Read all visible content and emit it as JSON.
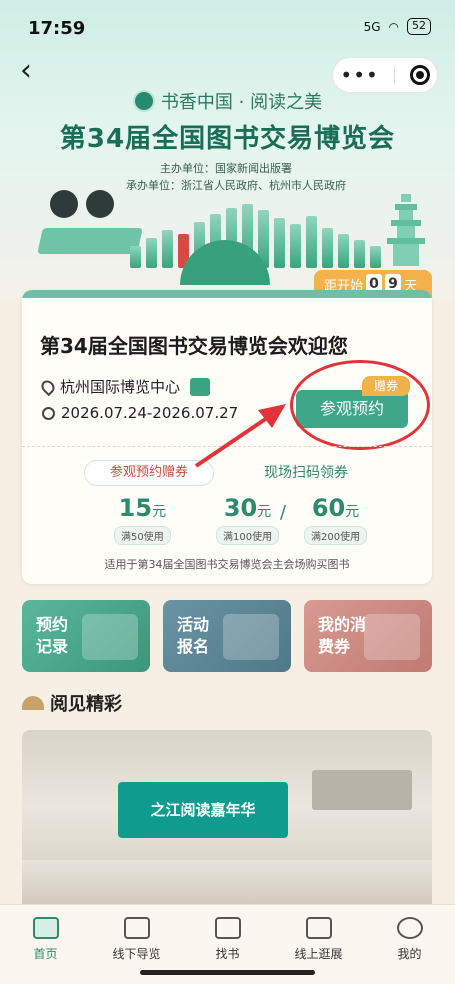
{
  "status_bar": {
    "time": "17:59",
    "battery": "52",
    "net": "5G"
  },
  "brand": {
    "name": "书香中国 · 阅读之美"
  },
  "header": {
    "title": "第34届全国图书交易博览会",
    "organizer": "主办单位：国家新闻出版署",
    "host": "承办单位：浙江省人民政府、杭州市人民政府"
  },
  "countdown": {
    "prefix": "距开始",
    "digits": [
      "0",
      "9"
    ],
    "suffix": "天"
  },
  "card": {
    "title": "第34届全国图书交易博览会欢迎您",
    "venue": "杭州国际博览中心",
    "dates": "2026.07.24-2026.07.27",
    "reserve_button": "参观预约",
    "gift_tag": "赠券",
    "label_reserve": "参观预约赠券",
    "label_onsite": "现场扫码领券",
    "coupons": [
      {
        "amount": "15",
        "unit": "元",
        "condition": "满50使用"
      },
      {
        "amount": "30",
        "unit": "元",
        "condition": "满100使用"
      },
      {
        "amount": "60",
        "unit": "元",
        "condition": "满200使用"
      }
    ],
    "slash": "/",
    "note": "适用于第34届全国图书交易博览会主会场购买图书"
  },
  "tiles": [
    {
      "label": "预约记录",
      "icon": "gate-icon"
    },
    {
      "label": "活动报名",
      "icon": "scroll-icon"
    },
    {
      "label": "我的消费券",
      "icon": "coupon-icon"
    }
  ],
  "section": {
    "title": "阅见精彩"
  },
  "photo": {
    "screen_text": "之江阅读嘉年华"
  },
  "tabs": [
    {
      "label": "首页",
      "icon": "home-icon",
      "active": true
    },
    {
      "label": "线下导览",
      "icon": "map-icon"
    },
    {
      "label": "找书",
      "icon": "book-icon"
    },
    {
      "label": "线上逛展",
      "icon": "pavilion-icon"
    },
    {
      "label": "我的",
      "icon": "person-icon"
    }
  ],
  "colors": {
    "accent": "#2d8a6d",
    "button": "#3da787",
    "highlight": "#e2333a",
    "countdown": "#f3b24c"
  }
}
